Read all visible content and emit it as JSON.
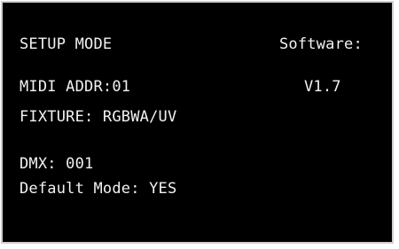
{
  "display": {
    "mode_title": "SETUP MODE",
    "software_label": "Software:",
    "midi_addr": "MIDI ADDR:01",
    "software_version": "V1.7",
    "fixture": "FIXTURE: RGBWA/UV",
    "dmx": "DMX: 001",
    "default_mode": "Default Mode: YES"
  },
  "colors": {
    "screen_background": "#000000",
    "text": "#f2f2f2",
    "bezel": "#cfcfcf"
  }
}
